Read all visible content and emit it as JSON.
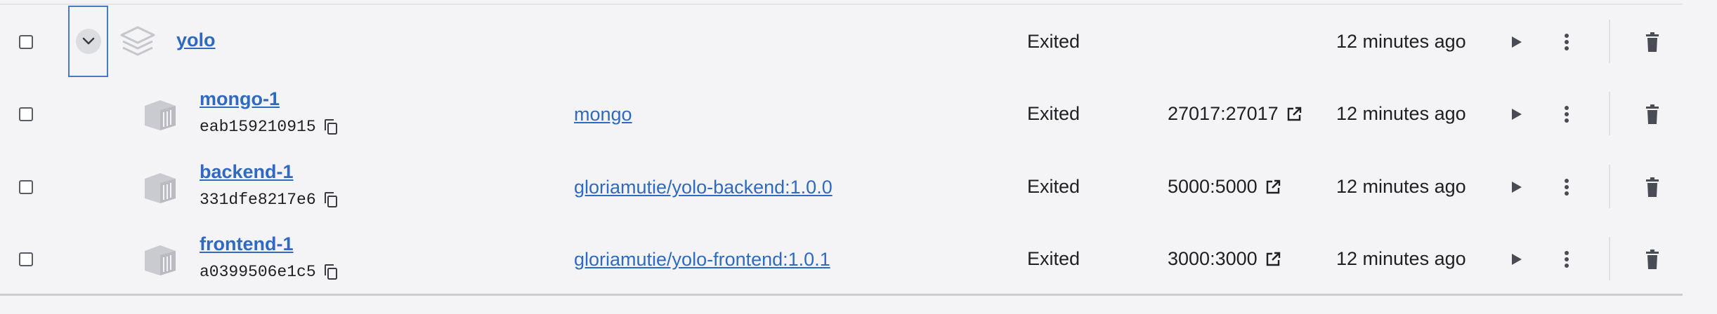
{
  "group": {
    "name": "yolo",
    "status": "Exited",
    "time": "12 minutes ago"
  },
  "containers": [
    {
      "name": "mongo-1",
      "id": "eab159210915",
      "image": "mongo",
      "status": "Exited",
      "ports": "27017:27017",
      "time": "12 minutes ago"
    },
    {
      "name": "backend-1",
      "id": "331dfe8217e6",
      "image": "gloriamutie/yolo-backend:1.0.0",
      "status": "Exited",
      "ports": "5000:5000",
      "time": "12 minutes ago"
    },
    {
      "name": "frontend-1",
      "id": "a0399506e1c5",
      "image": "gloriamutie/yolo-frontend:1.0.1",
      "status": "Exited",
      "ports": "3000:3000",
      "time": "12 minutes ago"
    }
  ],
  "icons": {
    "expand": "chevron-down-icon",
    "stack": "stack-layers-icon",
    "container": "container-icon",
    "copy": "copy-icon",
    "external": "external-link-icon",
    "start": "play-icon",
    "more": "more-vertical-icon",
    "delete": "trash-icon"
  },
  "colors": {
    "link": "#2f6ac2",
    "focus": "#4a78c9",
    "icon": "#5b5d66"
  }
}
